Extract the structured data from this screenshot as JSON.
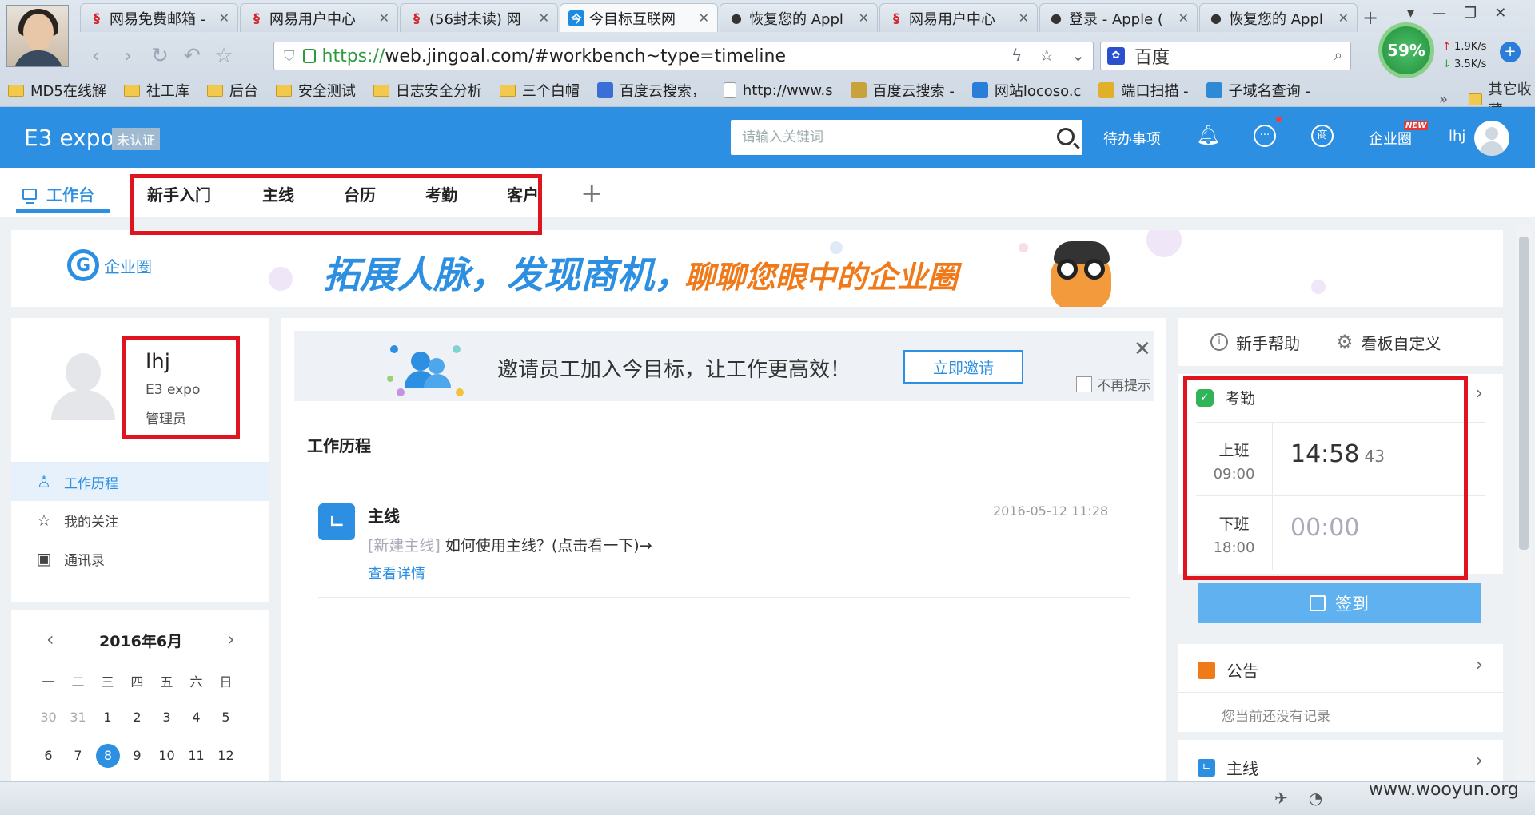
{
  "browser": {
    "tabs": [
      {
        "title": "网易免费邮箱 -",
        "fav": "wy",
        "active": false
      },
      {
        "title": "网易用户中心",
        "fav": "wy",
        "active": false
      },
      {
        "title": "(56封未读) 网",
        "fav": "wy",
        "active": false
      },
      {
        "title": "今目标互联网",
        "fav": "jg",
        "active": true
      },
      {
        "title": "恢复您的 Appl",
        "fav": "ap",
        "active": false
      },
      {
        "title": "网易用户中心",
        "fav": "wy",
        "active": false
      },
      {
        "title": "登录 - Apple (",
        "fav": "ap",
        "active": false
      },
      {
        "title": "恢复您的 Appl",
        "fav": "ap",
        "active": false
      }
    ],
    "url_scheme": "https://",
    "url_rest": "web.jingoal.com/#workbench~type=timeline",
    "search_engine": "百度",
    "speed_percent": "59%",
    "upload_rate": "1.9K/s",
    "download_rate": "3.5K/s",
    "bookmarks": [
      {
        "label": "MD5在线解",
        "type": "folder"
      },
      {
        "label": "社工库",
        "type": "folder"
      },
      {
        "label": "后台",
        "type": "folder"
      },
      {
        "label": "安全测试",
        "type": "folder"
      },
      {
        "label": "日志安全分析",
        "type": "folder"
      },
      {
        "label": "三个白帽",
        "type": "folder"
      },
      {
        "label": "百度云搜索，",
        "type": "link"
      },
      {
        "label": "http://www.s",
        "type": "page"
      },
      {
        "label": "百度云搜索 -",
        "type": "link"
      },
      {
        "label": "网站locoso.c",
        "type": "link"
      },
      {
        "label": "端口扫描 -",
        "type": "link"
      },
      {
        "label": "子域名查询 -",
        "type": "link"
      }
    ],
    "bookmarks_more": "»",
    "bookmarks_other": "其它收藏"
  },
  "app": {
    "logo": "E3 expo",
    "uncertified": "未认证",
    "search_placeholder": "请输入关键词",
    "todo": "待办事项",
    "shang_icon_label": "商",
    "qiye_circle": "企业圈",
    "new_badge": "NEW",
    "username": "lhj"
  },
  "subtabs": {
    "workbench": "工作台",
    "items": [
      "新手入门",
      "主线",
      "台历",
      "考勤",
      "客户"
    ],
    "add": "+"
  },
  "banner": {
    "logo_text": "企业圈",
    "slogan_blue": "拓展人脉，发现商机，",
    "slogan_orange": "聊聊您眼中的企业圈"
  },
  "profile": {
    "name": "lhj",
    "company": "E3 expo",
    "role": "管理员"
  },
  "leftnav": [
    {
      "label": "工作历程",
      "icon": "user-icon",
      "glyph": "♙",
      "active": true
    },
    {
      "label": "我的关注",
      "icon": "star-icon",
      "glyph": "☆",
      "active": false
    },
    {
      "label": "通讯录",
      "icon": "contacts-icon",
      "glyph": "▣",
      "active": false
    }
  ],
  "calendar": {
    "title": "2016年6月",
    "weekdays": [
      "一",
      "二",
      "三",
      "四",
      "五",
      "六",
      "日"
    ],
    "rows": [
      [
        {
          "d": "30",
          "gray": true
        },
        {
          "d": "31",
          "gray": true
        },
        {
          "d": "1"
        },
        {
          "d": "2"
        },
        {
          "d": "3"
        },
        {
          "d": "4"
        },
        {
          "d": "5"
        }
      ],
      [
        {
          "d": "6"
        },
        {
          "d": "7"
        },
        {
          "d": "8",
          "today": true
        },
        {
          "d": "9"
        },
        {
          "d": "10"
        },
        {
          "d": "11"
        },
        {
          "d": "12"
        }
      ]
    ]
  },
  "invite": {
    "text": "邀请员工加入今目标，让工作更高效！",
    "button": "立即邀请",
    "no_show": "不再提示",
    "close": "✕"
  },
  "history": {
    "title": "工作历程",
    "entry": {
      "icon_glyph": "ㄴ",
      "title": "主线",
      "time": "2016-05-12 11:28",
      "tag": "[新建主线]",
      "desc": " 如何使用主线？(点击看一下)→",
      "link": "查看详情"
    }
  },
  "right": {
    "help": "新手帮助",
    "customize": "看板自定义",
    "attendance": {
      "title": "考勤",
      "on_label": "上班",
      "on_time": "09:00",
      "on_value": "14:58",
      "on_seconds": "43",
      "off_label": "下班",
      "off_time": "18:00",
      "off_value": "00:00"
    },
    "signin": "签到",
    "notice": {
      "title": "公告",
      "empty": "您当前还没有记录"
    },
    "mainline": {
      "title": "主线"
    }
  },
  "watermark": "www.wooyun.org",
  "colors": {
    "brand_blue": "#2d8fe1",
    "highlight_red": "#e0141e",
    "orange": "#f07a1a"
  }
}
